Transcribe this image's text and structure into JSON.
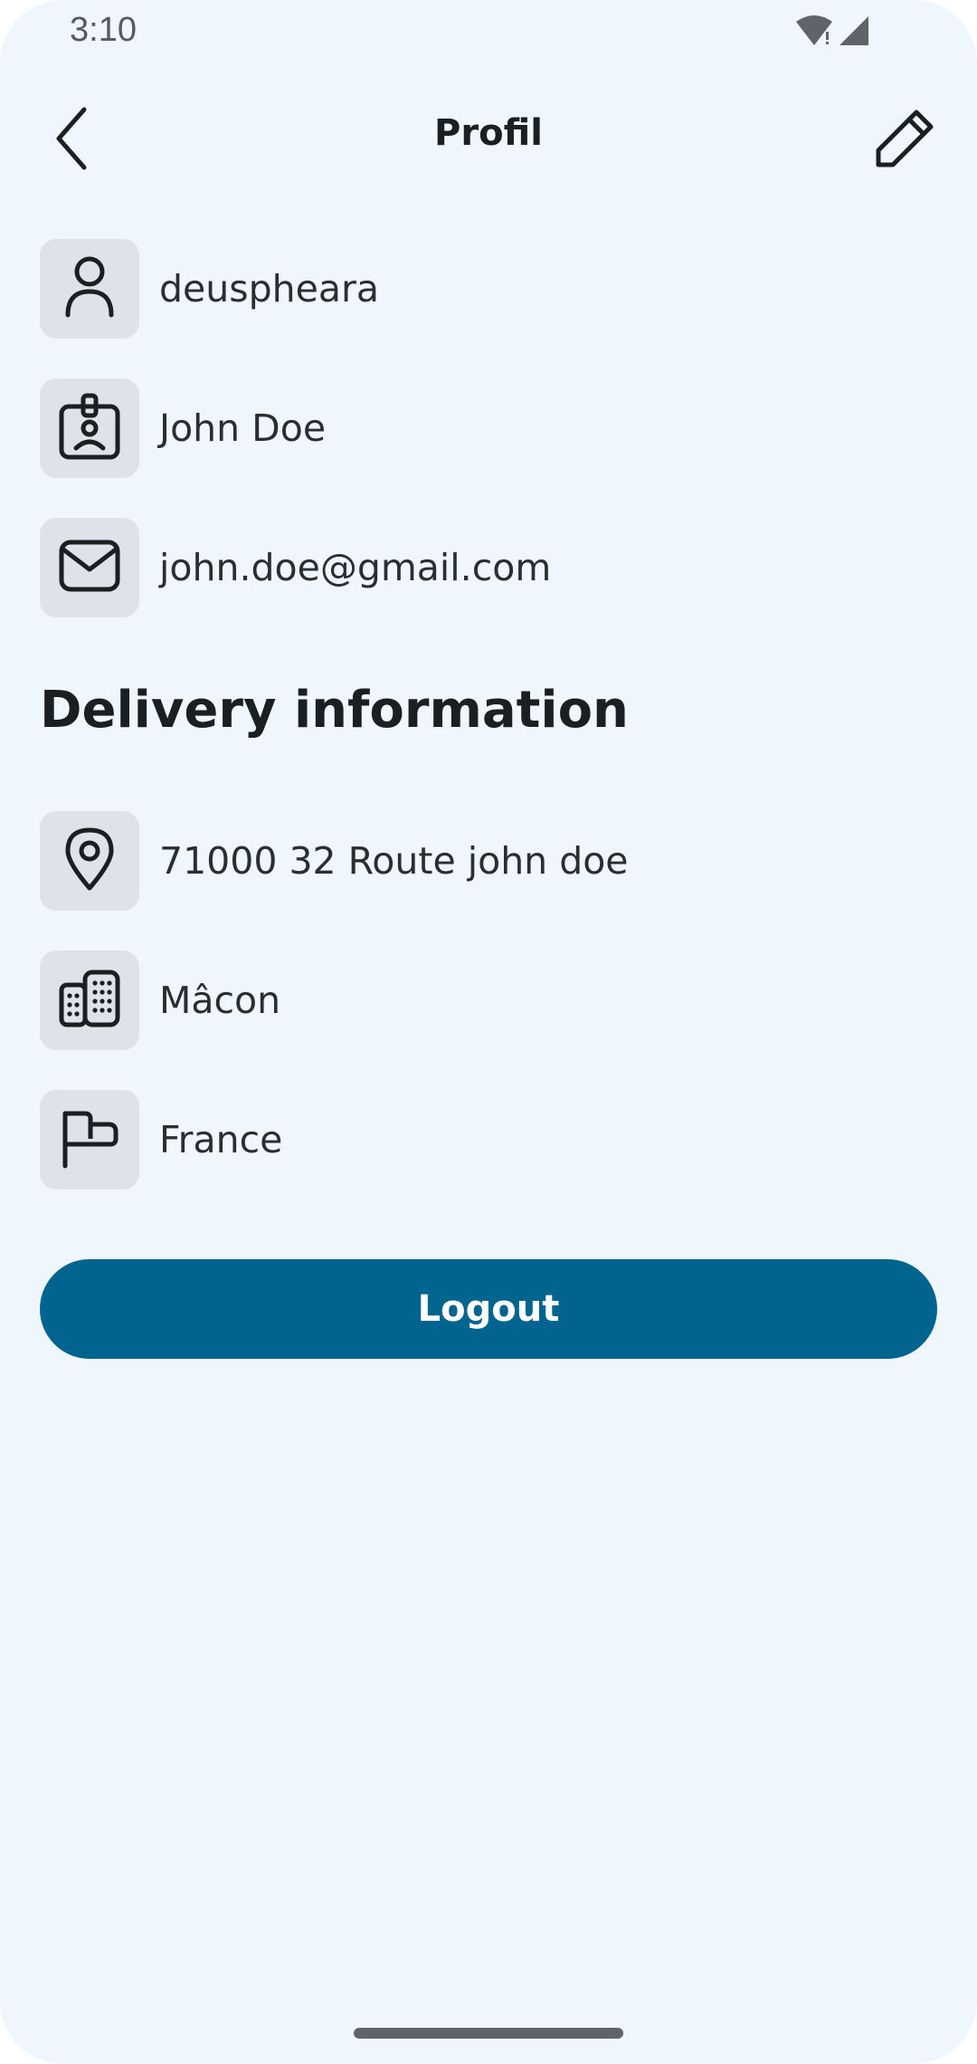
{
  "status_bar": {
    "time": "3:10"
  },
  "top_bar": {
    "title": "Profil",
    "back_icon": "chevron-left-icon",
    "edit_icon": "pencil-icon"
  },
  "profile": {
    "username": "deuspheara",
    "full_name": "John Doe",
    "email": "john.doe@gmail.com"
  },
  "delivery": {
    "title": "Delivery information",
    "address": "71000 32 Route john doe",
    "city": "Mâcon",
    "country": "France"
  },
  "actions": {
    "logout_label": "Logout"
  },
  "colors": {
    "background": "#eff7fd",
    "icon_tile": "#dde3e8",
    "primary": "#00658e",
    "text": "#1b1f22"
  }
}
